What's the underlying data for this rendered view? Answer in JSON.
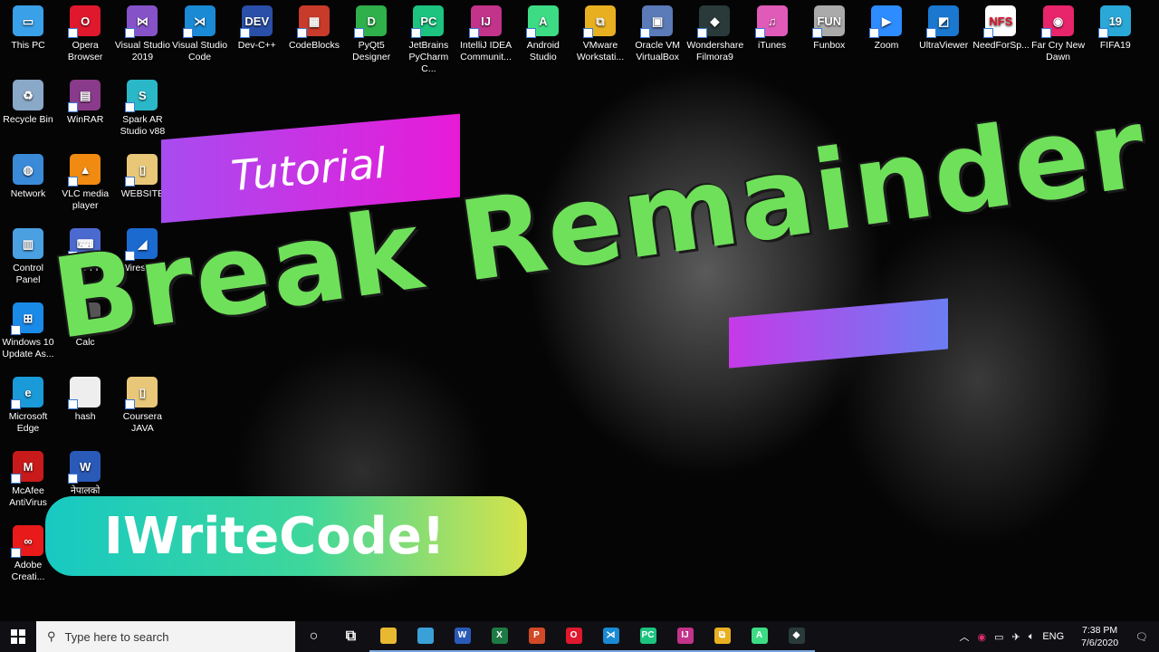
{
  "desktop_icons": [
    {
      "label": "This PC",
      "col": 0,
      "row": 0,
      "color": "#3aa0e8",
      "glyph": "▭"
    },
    {
      "label": "Opera Browser",
      "col": 1,
      "row": 0,
      "color": "#e0182d",
      "glyph": "O"
    },
    {
      "label": "Visual Studio 2019",
      "col": 2,
      "row": 0,
      "color": "#8652c8",
      "glyph": "⋈"
    },
    {
      "label": "Visual Studio Code",
      "col": 3,
      "row": 0,
      "color": "#1a8ad4",
      "glyph": "⋊"
    },
    {
      "label": "Dev-C++",
      "col": 4,
      "row": 0,
      "color": "#2a4fa8",
      "glyph": "DEV"
    },
    {
      "label": "CodeBlocks",
      "col": 5,
      "row": 0,
      "color": "#c83a2a",
      "glyph": "▦"
    },
    {
      "label": "PyQt5 Designer",
      "col": 6,
      "row": 0,
      "color": "#2fb04a",
      "glyph": "D"
    },
    {
      "label": "JetBrains PyCharm C...",
      "col": 7,
      "row": 0,
      "color": "#1cc480",
      "glyph": "PC"
    },
    {
      "label": "IntelliJ IDEA Communit...",
      "col": 8,
      "row": 0,
      "color": "#c2338a",
      "glyph": "IJ"
    },
    {
      "label": "Android Studio",
      "col": 9,
      "row": 0,
      "color": "#3ddc84",
      "glyph": "A"
    },
    {
      "label": "VMware Workstati...",
      "col": 10,
      "row": 0,
      "color": "#e8b020",
      "glyph": "⧉"
    },
    {
      "label": "Oracle VM VirtualBox",
      "col": 11,
      "row": 0,
      "color": "#5a7ab8",
      "glyph": "▣"
    },
    {
      "label": "Wondershare Filmora9",
      "col": 12,
      "row": 0,
      "color": "#2a3a3a",
      "glyph": "◆"
    },
    {
      "label": "iTunes",
      "col": 13,
      "row": 0,
      "color": "#e05ab8",
      "glyph": "♫"
    },
    {
      "label": "Funbox",
      "col": 14,
      "row": 0,
      "color": "#aaaaaa",
      "glyph": "FUN"
    },
    {
      "label": "Zoom",
      "col": 15,
      "row": 0,
      "color": "#2d8cff",
      "glyph": "▶"
    },
    {
      "label": "UltraViewer",
      "col": 16,
      "row": 0,
      "color": "#1a78d0",
      "glyph": "◩"
    },
    {
      "label": "NeedForSp...",
      "col": 17,
      "row": 0,
      "color": "#ffffff",
      "glyph": "NFS"
    },
    {
      "label": "Far Cry New Dawn",
      "col": 18,
      "row": 0,
      "color": "#e8246a",
      "glyph": "◉"
    },
    {
      "label": "FIFA19",
      "col": 19,
      "row": 0,
      "color": "#2aa8d8",
      "glyph": "19"
    },
    {
      "label": "Recycle Bin",
      "col": 0,
      "row": 1,
      "color": "#8aa8c8",
      "glyph": "♻"
    },
    {
      "label": "WinRAR",
      "col": 1,
      "row": 1,
      "color": "#8a3a8a",
      "glyph": "▤"
    },
    {
      "label": "Spark AR Studio v88",
      "col": 2,
      "row": 1,
      "color": "#2ab8c8",
      "glyph": "S"
    },
    {
      "label": "Network",
      "col": 0,
      "row": 2,
      "color": "#3a8ad8",
      "glyph": "◍"
    },
    {
      "label": "VLC media player",
      "col": 1,
      "row": 2,
      "color": "#f08a10",
      "glyph": "▲"
    },
    {
      "label": "WEBSITE",
      "col": 2,
      "row": 2,
      "color": "#e8c878",
      "glyph": "▯"
    },
    {
      "label": "Control Panel",
      "col": 0,
      "row": 3,
      "color": "#4aa0e0",
      "glyph": "▥"
    },
    {
      "label": "PuTTY",
      "col": 1,
      "row": 3,
      "color": "#4a6ad0",
      "glyph": "⌨"
    },
    {
      "label": "Wireshark",
      "col": 2,
      "row": 3,
      "color": "#1a6ad0",
      "glyph": "◢"
    },
    {
      "label": "Windows 10 Update As...",
      "col": 0,
      "row": 4,
      "color": "#1a8ae8",
      "glyph": "⊞"
    },
    {
      "label": "Calc",
      "col": 1,
      "row": 4,
      "color": "#555555",
      "glyph": "="
    },
    {
      "label": "Microsoft Edge",
      "col": 0,
      "row": 5,
      "color": "#1a9ad8",
      "glyph": "e"
    },
    {
      "label": "hash",
      "col": 1,
      "row": 5,
      "color": "#eeeeee",
      "glyph": ""
    },
    {
      "label": "Coursera JAVA",
      "col": 2,
      "row": 5,
      "color": "#e8c878",
      "glyph": "▯"
    },
    {
      "label": "McAfee AntiVirus",
      "col": 0,
      "row": 6,
      "color": "#c81a1a",
      "glyph": "M"
    },
    {
      "label": "नेपालको",
      "col": 1,
      "row": 6,
      "color": "#2a5ab8",
      "glyph": "W"
    },
    {
      "label": "Adobe Creati...",
      "col": 0,
      "row": 7,
      "color": "#e81a1a",
      "glyph": "∞"
    }
  ],
  "overlay": {
    "tutorial": "Tutorial",
    "title": "Break Remainder",
    "brand": "IWriteCode!"
  },
  "taskbar": {
    "search_placeholder": "Type here to search",
    "apps": [
      {
        "name": "cortana",
        "color": "transparent",
        "glyph": "○"
      },
      {
        "name": "task-view",
        "color": "transparent",
        "glyph": "⧉"
      },
      {
        "name": "file-explorer",
        "color": "#e8b830",
        "glyph": ""
      },
      {
        "name": "photos",
        "color": "#3aa0d8",
        "glyph": ""
      },
      {
        "name": "word",
        "color": "#2a5ab8",
        "glyph": "W"
      },
      {
        "name": "excel",
        "color": "#1e7a44",
        "glyph": "X"
      },
      {
        "name": "powerpoint",
        "color": "#d04a28",
        "glyph": "P"
      },
      {
        "name": "opera",
        "color": "#e0182d",
        "glyph": "O"
      },
      {
        "name": "vscode",
        "color": "#1a8ad4",
        "glyph": "⋊"
      },
      {
        "name": "pycharm",
        "color": "#1cc480",
        "glyph": "PC"
      },
      {
        "name": "intellij",
        "color": "#c2338a",
        "glyph": "IJ"
      },
      {
        "name": "vmware",
        "color": "#e8b020",
        "glyph": "⧉"
      },
      {
        "name": "android-studio",
        "color": "#3ddc84",
        "glyph": "A"
      },
      {
        "name": "filmora",
        "color": "#2a3a3a",
        "glyph": "◆"
      }
    ],
    "language": "ENG",
    "time": "7:38 PM",
    "date": "7/6/2020"
  }
}
